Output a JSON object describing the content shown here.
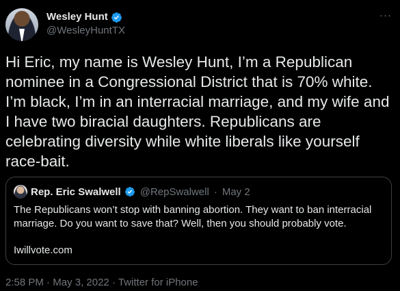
{
  "author": {
    "display_name": "Wesley Hunt",
    "handle": "@WesleyHuntTX",
    "verified": true
  },
  "more_icon": "···",
  "tweet_text": "Hi Eric, my name is Wesley Hunt, I’m a Republican nominee in a Congressional District that is 70% white. I’m black, I’m in an interracial marriage, and my wife and I have two biracial daughters. Republicans are celebrating diversity while white liberals like yourself race-bait.",
  "quoted_tweet": {
    "display_name": "Rep. Eric Swalwell",
    "handle": "@RepSwalwell",
    "separator": "·",
    "date": "May 2",
    "text": "The Republicans won’t stop with banning abortion. They want to ban interracial marriage. Do you want to save that? Well, then you should probably vote.",
    "link": "Iwillvote.com"
  },
  "footer": {
    "time": "2:58 PM",
    "separator": "·",
    "date": "May 3, 2022",
    "source": "Twitter for iPhone"
  },
  "colors": {
    "background": "#000000",
    "text": "#e7e9ea",
    "muted": "#71767b",
    "verified": "#1d9bf0",
    "border": "#3e4144"
  }
}
